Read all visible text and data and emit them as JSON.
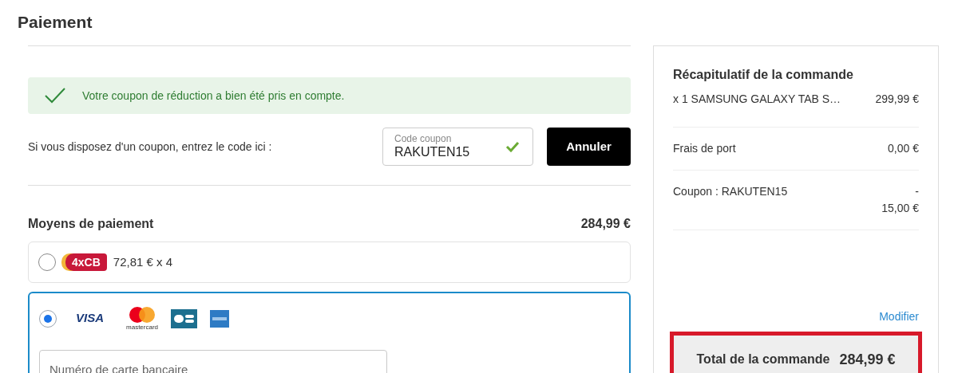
{
  "page_title": "Paiement",
  "coupon_notice": {
    "message": "Votre coupon de réduction a bien été pris en compte."
  },
  "coupon": {
    "prompt": "Si vous disposez d'un coupon, entrez le code ici :",
    "field_label": "Code coupon",
    "value": "RAKUTEN15",
    "valid": true,
    "button": "Annuler"
  },
  "payment": {
    "heading": "Moyens de paiement",
    "amount": "284,99 €",
    "options": [
      {
        "kind": "installment",
        "selected": false,
        "badge": "4xCB",
        "text": "72,81 € x 4"
      },
      {
        "kind": "card",
        "selected": true,
        "visa": "VISA",
        "mastercard": "mastercard",
        "card_number_placeholder": "Numéro de carte bancaire"
      }
    ]
  },
  "summary": {
    "title": "Récapitulatif de la commande",
    "lines": [
      {
        "label": "x 1 SAMSUNG GALAXY TAB S…",
        "value": "299,99 €"
      },
      {
        "label": "Frais de port",
        "value": "0,00 €"
      },
      {
        "label": "Coupon : RAKUTEN15",
        "value": "-\n15,00 €"
      }
    ],
    "modify_link": "Modifier",
    "total_label": "Total de la commande",
    "total_value": "284,99 €"
  }
}
